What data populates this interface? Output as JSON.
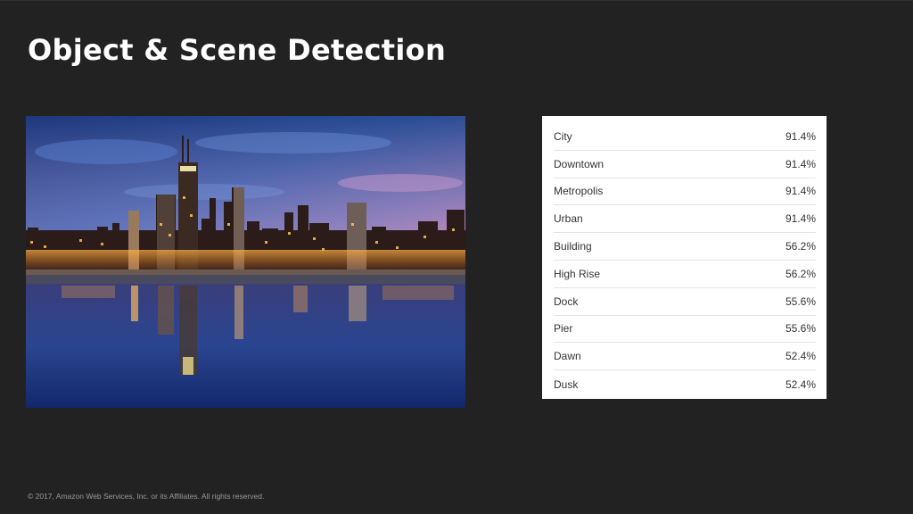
{
  "slide": {
    "title": "Object & Scene Detection",
    "copyright": "© 2017, Amazon Web Services, Inc. or its Affiliates. All rights reserved."
  },
  "photo": {
    "subject": "city-skyline-at-dusk-photo"
  },
  "labels": [
    {
      "name": "City",
      "confidence": "91.4%"
    },
    {
      "name": "Downtown",
      "confidence": "91.4%"
    },
    {
      "name": "Metropolis",
      "confidence": "91.4%"
    },
    {
      "name": "Urban",
      "confidence": "91.4%"
    },
    {
      "name": "Building",
      "confidence": "56.2%"
    },
    {
      "name": "High Rise",
      "confidence": "56.2%"
    },
    {
      "name": "Dock",
      "confidence": "55.6%"
    },
    {
      "name": "Pier",
      "confidence": "55.6%"
    },
    {
      "name": "Dawn",
      "confidence": "52.4%"
    },
    {
      "name": "Dusk",
      "confidence": "52.4%"
    }
  ],
  "colors": {
    "background": "#222222",
    "title": "#ffffff",
    "table_background": "#ffffff"
  }
}
